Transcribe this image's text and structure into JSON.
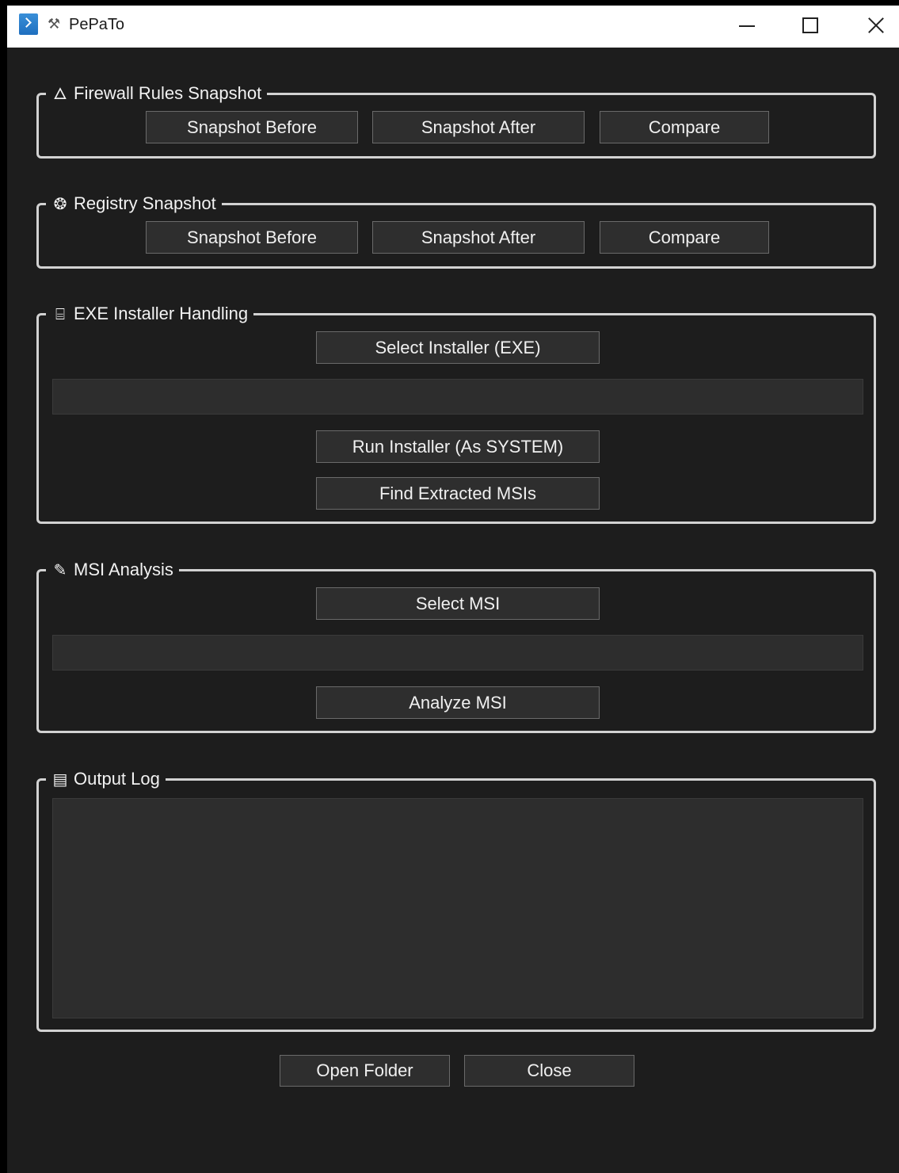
{
  "window": {
    "title": "PePaTo",
    "title_prefix_icon": "tools-icon",
    "app_icon": "powershell-icon",
    "controls": {
      "minimize": "minimize-icon",
      "maximize": "maximize-icon",
      "close": "close-icon"
    }
  },
  "colors": {
    "background": "#1d1d1d",
    "frame": "#d2d2d2",
    "button": "#2e2e2e",
    "field": "#2d2d2d",
    "text": "#f0f0f0"
  },
  "firewall": {
    "legend": "Firewall Rules Snapshot",
    "icon": "flame-icon",
    "snapshot_before": "Snapshot Before",
    "snapshot_after": "Snapshot After",
    "compare": "Compare"
  },
  "registry": {
    "legend": "Registry Snapshot",
    "icon": "brain-icon",
    "snapshot_before": "Snapshot Before",
    "snapshot_after": "Snapshot After",
    "compare": "Compare"
  },
  "exe": {
    "legend": "EXE Installer Handling",
    "icon": "package-icon",
    "select_installer": "Select Installer (EXE)",
    "path_value": "",
    "run_installer": "Run Installer (As SYSTEM)",
    "find_msis": "Find Extracted MSIs"
  },
  "msi": {
    "legend": "MSI Analysis",
    "icon": "pipette-icon",
    "select_msi": "Select MSI",
    "path_value": "",
    "analyze_msi": "Analyze MSI"
  },
  "log": {
    "legend": "Output Log",
    "icon": "clipboard-icon",
    "content": ""
  },
  "footer": {
    "open_folder": "Open Folder",
    "close": "Close"
  }
}
